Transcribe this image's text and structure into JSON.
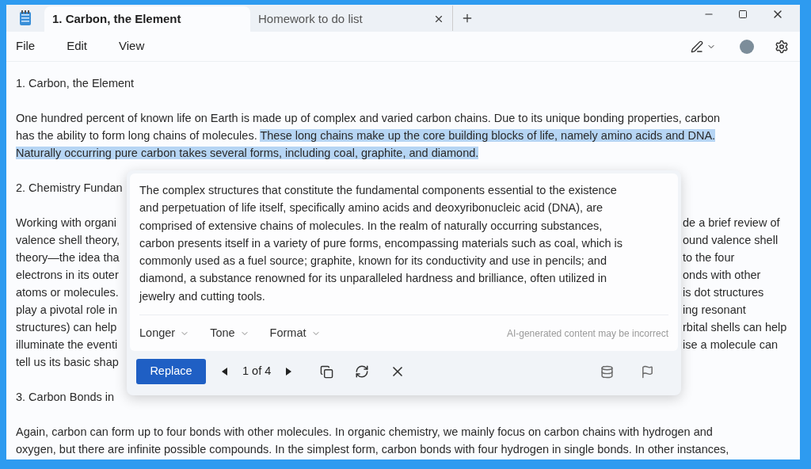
{
  "tabs": [
    {
      "label": "1. Carbon, the Element",
      "selected": true
    },
    {
      "label": "Homework to do list",
      "selected": false
    }
  ],
  "menu": [
    "File",
    "Edit",
    "View"
  ],
  "document": {
    "heading": "1. Carbon, the Element",
    "paragraph_1": [
      [
        {
          "text": "One hundred percent of known life on Earth is made up of complex and varied carbon chains. Due to its unique bonding properties, carbon",
          "selected": false
        }
      ],
      [
        {
          "text": "has the ability to form long chains of molecules. ",
          "selected": false
        },
        {
          "text": "These long chains make up the core building blocks of life, namely amino acids and DNA.",
          "selected": true
        }
      ],
      [
        {
          "text": "Naturally occurring pure carbon takes several forms, including coal, graphite, and diamond.",
          "selected": true
        }
      ]
    ],
    "heading_2": {
      "left": "2. Chemistry Fundan"
    },
    "paragraph_2": [
      {
        "left": "Working with organi",
        "right": "de a brief review of"
      },
      {
        "left": "valence shell theory,",
        "right": "ound valence shell"
      },
      {
        "left": "theory—the idea tha",
        "right": "to the four"
      },
      {
        "left": "electrons in its outer",
        "right": "onds with other"
      },
      {
        "left": "atoms or molecules.",
        "right": "is dot structures"
      },
      {
        "left": "play a pivotal role in",
        "right": "ing resonant"
      },
      {
        "left": "structures) can help",
        "right": "rbital shells can help"
      },
      {
        "left": "illuminate the eventi",
        "right": "ise a molecule can"
      },
      {
        "left": "tell us its basic shap"
      }
    ],
    "heading_3": {
      "left": "3. Carbon Bonds in"
    },
    "paragraph_3": [
      "Again, carbon can form up to four bonds with other molecules. In organic chemistry, we mainly focus on carbon chains with hydrogen and",
      "oxygen, but there are infinite possible compounds. In the simplest form, carbon bonds with four hydrogen in single bonds. In other instances,"
    ]
  },
  "rewrite_popup": {
    "text": [
      "The complex structures that constitute the fundamental components essential to the existence",
      "and perpetuation of life itself, specifically amino acids and deoxyribonucleic acid (DNA), are",
      "comprised of extensive chains of molecules. In the realm of naturally occurring substances,",
      "carbon presents itself in a variety of pure forms, encompassing materials such as coal, which is",
      "commonly used as a fuel source; graphite, known for its conductivity and use in pencils; and",
      "diamond, a substance renowned for its unparalleled hardness and brilliance, often utilized in",
      "jewelry and cutting tools."
    ],
    "options": [
      "Longer",
      "Tone",
      "Format"
    ],
    "disclaimer": "AI-generated content may be incorrect",
    "replace_button": "Replace",
    "pager": "1 of 4"
  }
}
